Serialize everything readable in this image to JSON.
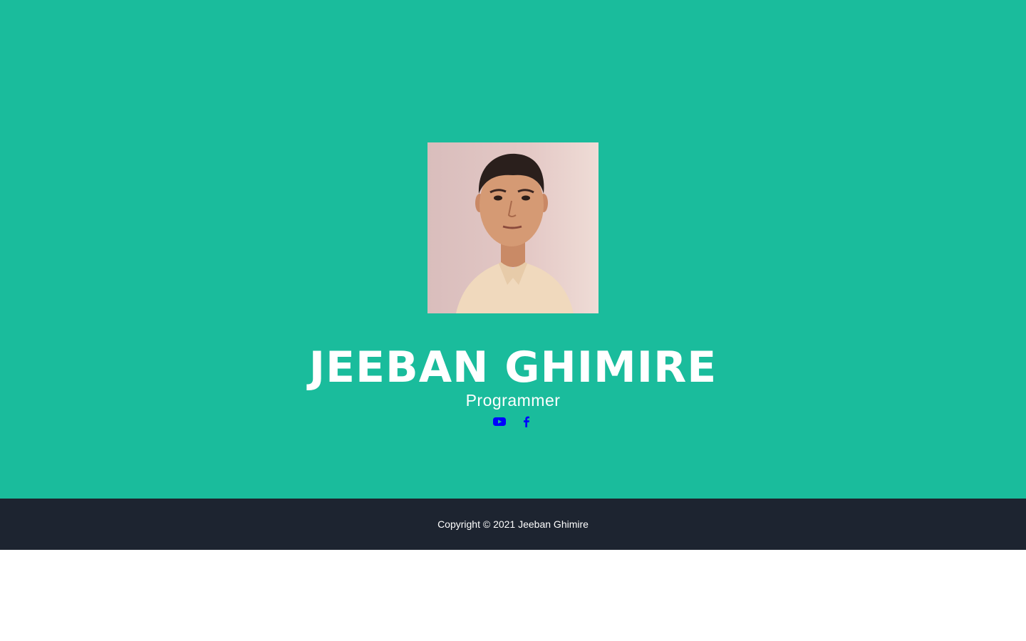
{
  "colors": {
    "masthead_bg": "#1abc9c",
    "footer_bg": "#1d2430",
    "text": "#ffffff",
    "social_icon": "#0000ff"
  },
  "profile": {
    "name": "JEEBAN GHIMIRE",
    "title": "Programmer"
  },
  "social": [
    {
      "icon": "youtube-icon"
    },
    {
      "icon": "facebook-icon"
    }
  ],
  "footer": {
    "copyright": "Copyright © 2021 Jeeban Ghimire"
  }
}
